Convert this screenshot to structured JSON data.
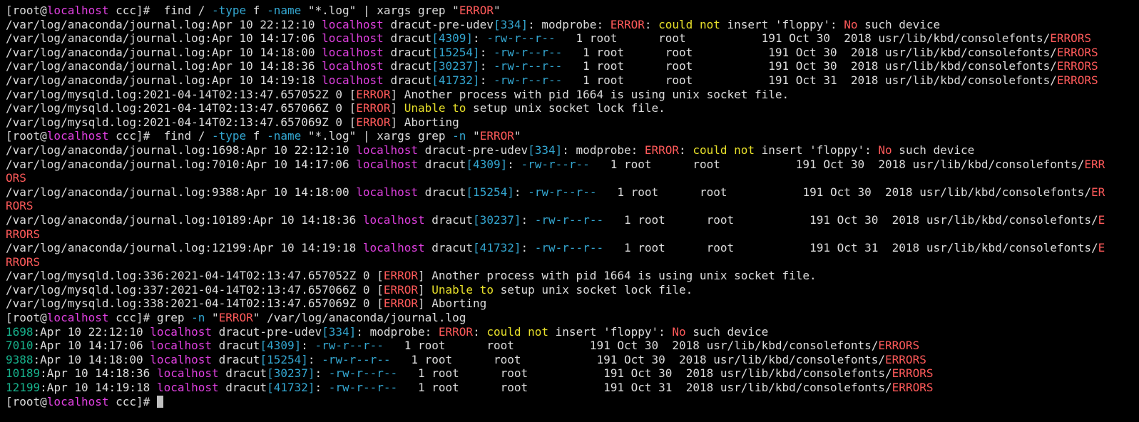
{
  "colors": {
    "text": "#dcdcdc",
    "magenta": "#e040e0",
    "cyan": "#33a6d0",
    "red": "#ff5a5a",
    "yellow": "#e8e02a",
    "green": "#17b28c",
    "cursor": "#c0c0c0"
  },
  "lines": [
    [
      [
        "t",
        "[root@"
      ],
      [
        "m",
        "localhost"
      ],
      [
        "t",
        " ccc]#  find / "
      ],
      [
        "c",
        "-type"
      ],
      [
        "t",
        " f "
      ],
      [
        "c",
        "-name"
      ],
      [
        "t",
        " \"*.log\" | xargs grep \""
      ],
      [
        "r",
        "ERROR"
      ],
      [
        "t",
        "\""
      ]
    ],
    [
      [
        "t",
        "/var/log/anaconda/journal.log:Apr 10 22:12:10 "
      ],
      [
        "m",
        "localhost"
      ],
      [
        "t",
        " dracut-pre-udev"
      ],
      [
        "c",
        "[334]"
      ],
      [
        "t",
        ": modprobe: "
      ],
      [
        "r",
        "ERROR"
      ],
      [
        "t",
        ": "
      ],
      [
        "y",
        "could not"
      ],
      [
        "t",
        " insert 'floppy': "
      ],
      [
        "r",
        "No"
      ],
      [
        "t",
        " such device"
      ]
    ],
    [
      [
        "t",
        "/var/log/anaconda/journal.log:Apr 10 14:17:06 "
      ],
      [
        "m",
        "localhost"
      ],
      [
        "t",
        " dracut"
      ],
      [
        "c",
        "[4309]"
      ],
      [
        "t",
        ": "
      ],
      [
        "c",
        "-rw-r--r--"
      ],
      [
        "t",
        "   1 root      root           191 Oct 30  2018 usr/lib/kbd/consolefonts/"
      ],
      [
        "r",
        "ERRORS"
      ]
    ],
    [
      [
        "t",
        "/var/log/anaconda/journal.log:Apr 10 14:18:00 "
      ],
      [
        "m",
        "localhost"
      ],
      [
        "t",
        " dracut"
      ],
      [
        "c",
        "[15254]"
      ],
      [
        "t",
        ": "
      ],
      [
        "c",
        "-rw-r--r--"
      ],
      [
        "t",
        "   1 root      root           191 Oct 30  2018 usr/lib/kbd/consolefonts/"
      ],
      [
        "r",
        "ERRORS"
      ]
    ],
    [
      [
        "t",
        "/var/log/anaconda/journal.log:Apr 10 14:18:36 "
      ],
      [
        "m",
        "localhost"
      ],
      [
        "t",
        " dracut"
      ],
      [
        "c",
        "[30237]"
      ],
      [
        "t",
        ": "
      ],
      [
        "c",
        "-rw-r--r--"
      ],
      [
        "t",
        "   1 root      root           191 Oct 30  2018 usr/lib/kbd/consolefonts/"
      ],
      [
        "r",
        "ERRORS"
      ]
    ],
    [
      [
        "t",
        "/var/log/anaconda/journal.log:Apr 10 14:19:18 "
      ],
      [
        "m",
        "localhost"
      ],
      [
        "t",
        " dracut"
      ],
      [
        "c",
        "[41732]"
      ],
      [
        "t",
        ": "
      ],
      [
        "c",
        "-rw-r--r--"
      ],
      [
        "t",
        "   1 root      root           191 Oct 31  2018 usr/lib/kbd/consolefonts/"
      ],
      [
        "r",
        "ERRORS"
      ]
    ],
    [
      [
        "t",
        "/var/log/mysqld.log:2021-04-14T02:13:47.657052Z 0 ["
      ],
      [
        "r",
        "ERROR"
      ],
      [
        "t",
        "] Another process with pid 1664 is using unix socket file."
      ]
    ],
    [
      [
        "t",
        "/var/log/mysqld.log:2021-04-14T02:13:47.657066Z 0 ["
      ],
      [
        "r",
        "ERROR"
      ],
      [
        "t",
        "] "
      ],
      [
        "y",
        "Unable to"
      ],
      [
        "t",
        " setup unix socket lock file."
      ]
    ],
    [
      [
        "t",
        "/var/log/mysqld.log:2021-04-14T02:13:47.657069Z 0 ["
      ],
      [
        "r",
        "ERROR"
      ],
      [
        "t",
        "] Aborting"
      ]
    ],
    [
      [
        "t",
        "[root@"
      ],
      [
        "m",
        "localhost"
      ],
      [
        "t",
        " ccc]#  find / "
      ],
      [
        "c",
        "-type"
      ],
      [
        "t",
        " f "
      ],
      [
        "c",
        "-name"
      ],
      [
        "t",
        " \"*.log\" | xargs grep "
      ],
      [
        "c",
        "-n"
      ],
      [
        "t",
        " \""
      ],
      [
        "r",
        "ERROR"
      ],
      [
        "t",
        "\""
      ]
    ],
    [
      [
        "t",
        "/var/log/anaconda/journal.log:1698:Apr 10 22:12:10 "
      ],
      [
        "m",
        "localhost"
      ],
      [
        "t",
        " dracut-pre-udev"
      ],
      [
        "c",
        "[334]"
      ],
      [
        "t",
        ": modprobe: "
      ],
      [
        "r",
        "ERROR"
      ],
      [
        "t",
        ": "
      ],
      [
        "y",
        "could not"
      ],
      [
        "t",
        " insert 'floppy': "
      ],
      [
        "r",
        "No"
      ],
      [
        "t",
        " such device"
      ]
    ],
    [
      [
        "t",
        "/var/log/anaconda/journal.log:7010:Apr 10 14:17:06 "
      ],
      [
        "m",
        "localhost"
      ],
      [
        "t",
        " dracut"
      ],
      [
        "c",
        "[4309]"
      ],
      [
        "t",
        ": "
      ],
      [
        "c",
        "-rw-r--r--"
      ],
      [
        "t",
        "   1 root      root           191 Oct 30  2018 usr/lib/kbd/consolefonts/"
      ],
      [
        "r",
        "ERR"
      ]
    ],
    [
      [
        "r",
        "ORS"
      ]
    ],
    [
      [
        "t",
        "/var/log/anaconda/journal.log:9388:Apr 10 14:18:00 "
      ],
      [
        "m",
        "localhost"
      ],
      [
        "t",
        " dracut"
      ],
      [
        "c",
        "[15254]"
      ],
      [
        "t",
        ": "
      ],
      [
        "c",
        "-rw-r--r--"
      ],
      [
        "t",
        "   1 root      root           191 Oct 30  2018 usr/lib/kbd/consolefonts/"
      ],
      [
        "r",
        "ER"
      ]
    ],
    [
      [
        "r",
        "RORS"
      ]
    ],
    [
      [
        "t",
        "/var/log/anaconda/journal.log:10189:Apr 10 14:18:36 "
      ],
      [
        "m",
        "localhost"
      ],
      [
        "t",
        " dracut"
      ],
      [
        "c",
        "[30237]"
      ],
      [
        "t",
        ": "
      ],
      [
        "c",
        "-rw-r--r--"
      ],
      [
        "t",
        "   1 root      root           191 Oct 30  2018 usr/lib/kbd/consolefonts/"
      ],
      [
        "r",
        "E"
      ]
    ],
    [
      [
        "r",
        "RRORS"
      ]
    ],
    [
      [
        "t",
        "/var/log/anaconda/journal.log:12199:Apr 10 14:19:18 "
      ],
      [
        "m",
        "localhost"
      ],
      [
        "t",
        " dracut"
      ],
      [
        "c",
        "[41732]"
      ],
      [
        "t",
        ": "
      ],
      [
        "c",
        "-rw-r--r--"
      ],
      [
        "t",
        "   1 root      root           191 Oct 31  2018 usr/lib/kbd/consolefonts/"
      ],
      [
        "r",
        "E"
      ]
    ],
    [
      [
        "r",
        "RRORS"
      ]
    ],
    [
      [
        "t",
        "/var/log/mysqld.log:336:2021-04-14T02:13:47.657052Z 0 ["
      ],
      [
        "r",
        "ERROR"
      ],
      [
        "t",
        "] Another process with pid 1664 is using unix socket file."
      ]
    ],
    [
      [
        "t",
        "/var/log/mysqld.log:337:2021-04-14T02:13:47.657066Z 0 ["
      ],
      [
        "r",
        "ERROR"
      ],
      [
        "t",
        "] "
      ],
      [
        "y",
        "Unable to"
      ],
      [
        "t",
        " setup unix socket lock file."
      ]
    ],
    [
      [
        "t",
        "/var/log/mysqld.log:338:2021-04-14T02:13:47.657069Z 0 ["
      ],
      [
        "r",
        "ERROR"
      ],
      [
        "t",
        "] Aborting"
      ]
    ],
    [
      [
        "t",
        "[root@"
      ],
      [
        "m",
        "localhost"
      ],
      [
        "t",
        " ccc]# grep "
      ],
      [
        "c",
        "-n"
      ],
      [
        "t",
        " \""
      ],
      [
        "r",
        "ERROR"
      ],
      [
        "t",
        "\" /var/log/anaconda/journal.log"
      ]
    ],
    [
      [
        "g",
        "1698"
      ],
      [
        "t",
        ":Apr 10 22:12:10 "
      ],
      [
        "m",
        "localhost"
      ],
      [
        "t",
        " dracut-pre-udev"
      ],
      [
        "c",
        "[334]"
      ],
      [
        "t",
        ": modprobe: "
      ],
      [
        "r",
        "ERROR"
      ],
      [
        "t",
        ": "
      ],
      [
        "y",
        "could not"
      ],
      [
        "t",
        " insert 'floppy': "
      ],
      [
        "r",
        "No"
      ],
      [
        "t",
        " such device"
      ]
    ],
    [
      [
        "g",
        "7010"
      ],
      [
        "t",
        ":Apr 10 14:17:06 "
      ],
      [
        "m",
        "localhost"
      ],
      [
        "t",
        " dracut"
      ],
      [
        "c",
        "[4309]"
      ],
      [
        "t",
        ": "
      ],
      [
        "c",
        "-rw-r--r--"
      ],
      [
        "t",
        "   1 root      root           191 Oct 30  2018 usr/lib/kbd/consolefonts/"
      ],
      [
        "r",
        "ERRORS"
      ]
    ],
    [
      [
        "g",
        "9388"
      ],
      [
        "t",
        ":Apr 10 14:18:00 "
      ],
      [
        "m",
        "localhost"
      ],
      [
        "t",
        " dracut"
      ],
      [
        "c",
        "[15254]"
      ],
      [
        "t",
        ": "
      ],
      [
        "c",
        "-rw-r--r--"
      ],
      [
        "t",
        "   1 root      root           191 Oct 30  2018 usr/lib/kbd/consolefonts/"
      ],
      [
        "r",
        "ERRORS"
      ]
    ],
    [
      [
        "g",
        "10189"
      ],
      [
        "t",
        ":Apr 10 14:18:36 "
      ],
      [
        "m",
        "localhost"
      ],
      [
        "t",
        " dracut"
      ],
      [
        "c",
        "[30237]"
      ],
      [
        "t",
        ": "
      ],
      [
        "c",
        "-rw-r--r--"
      ],
      [
        "t",
        "   1 root      root           191 Oct 30  2018 usr/lib/kbd/consolefonts/"
      ],
      [
        "r",
        "ERRORS"
      ]
    ],
    [
      [
        "g",
        "12199"
      ],
      [
        "t",
        ":Apr 10 14:19:18 "
      ],
      [
        "m",
        "localhost"
      ],
      [
        "t",
        " dracut"
      ],
      [
        "c",
        "[41732]"
      ],
      [
        "t",
        ": "
      ],
      [
        "c",
        "-rw-r--r--"
      ],
      [
        "t",
        "   1 root      root           191 Oct 31  2018 usr/lib/kbd/consolefonts/"
      ],
      [
        "r",
        "ERRORS"
      ]
    ],
    [
      [
        "t",
        "[root@"
      ],
      [
        "m",
        "localhost"
      ],
      [
        "t",
        " ccc]# "
      ],
      [
        "cursor",
        ""
      ]
    ]
  ]
}
